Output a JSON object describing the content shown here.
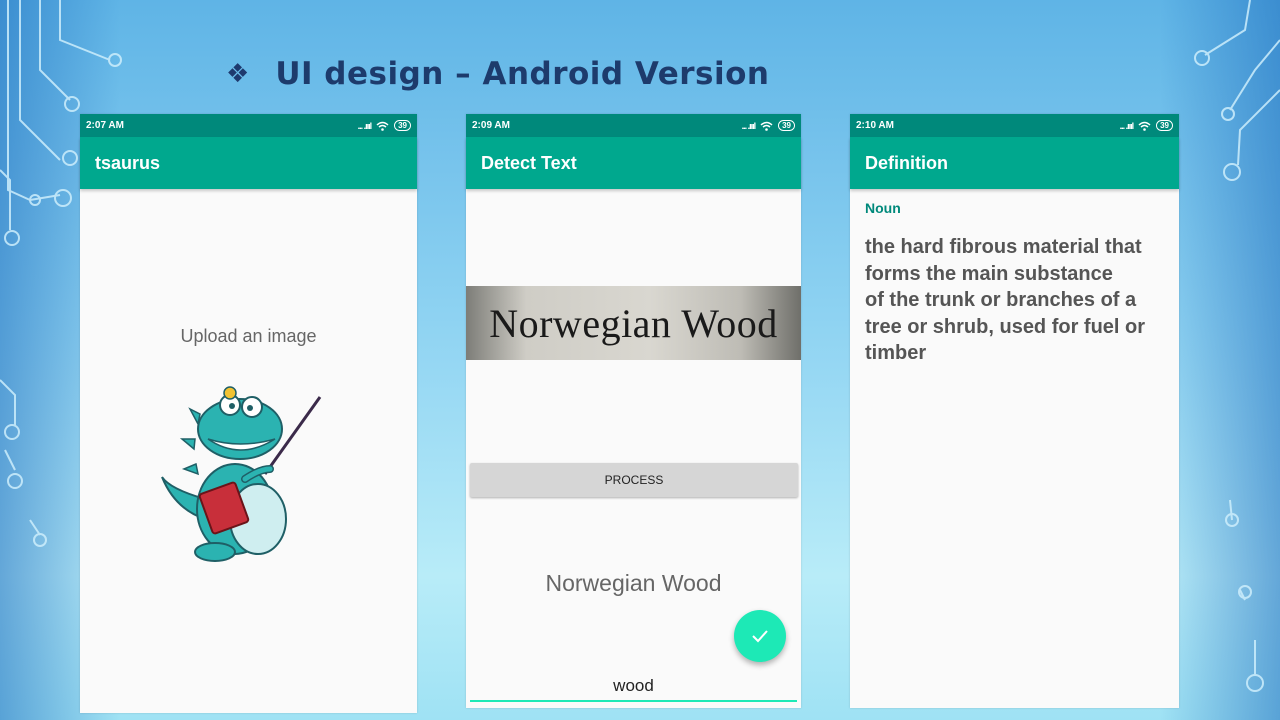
{
  "slide": {
    "bullet": "❖",
    "title": "UI design – Android Version"
  },
  "colors": {
    "status_bar": "#00897b",
    "app_bar": "#00a88e",
    "fab": "#1de9b6",
    "noun_label": "#00897b"
  },
  "phones": [
    {
      "status": {
        "time": "2:07 AM",
        "signal": "... .ıııl",
        "battery": "39"
      },
      "app_title": "tsaurus",
      "upload_label": "Upload an image",
      "illustration": "dinosaur-teacher-mascot"
    },
    {
      "status": {
        "time": "2:09 AM",
        "signal": "... .ıııl",
        "battery": "39"
      },
      "app_title": "Detect Text",
      "scanned_image_text": "Norwegian Wood",
      "process_label": "PROCESS",
      "result_text": "Norwegian Wood",
      "fab_icon": "check-icon",
      "input_value": "wood"
    },
    {
      "status": {
        "time": "2:10 AM",
        "signal": "... .ıııl",
        "battery": "39"
      },
      "app_title": "Definition",
      "part_of_speech": "Noun",
      "definition_lines": [
        "the hard fibrous material that",
        "forms the main substance",
        "of the trunk or branches of a",
        "tree or shrub, used for fuel or",
        "timber"
      ]
    }
  ]
}
